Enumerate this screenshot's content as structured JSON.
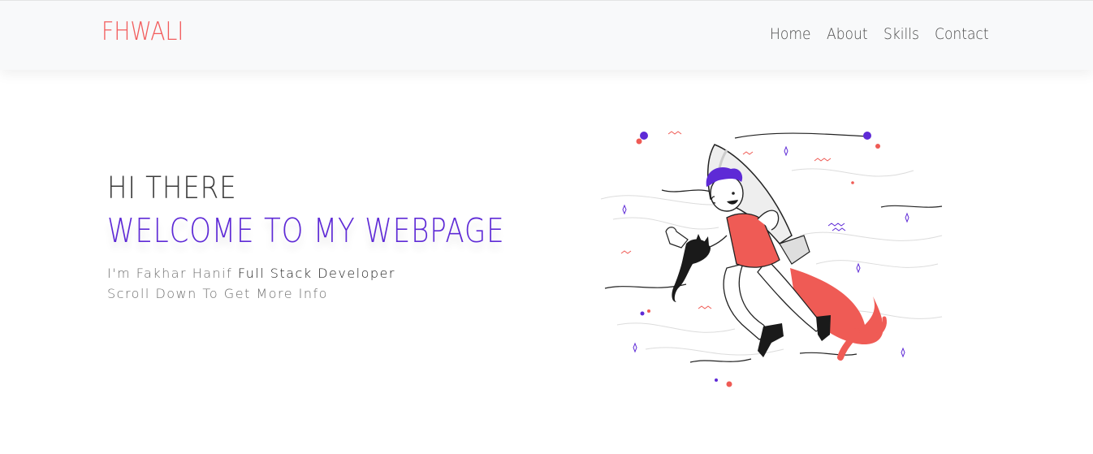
{
  "navbar": {
    "brand": "FHWALI",
    "links": [
      "Home",
      "About",
      "Skills",
      "Contact"
    ]
  },
  "hero": {
    "greeting": "HI THERE",
    "headline": "WELCOME TO MY WEBPAGE",
    "intro_prefix": "I'm Fakhar Hanif",
    "intro_role": "Full Stack Developer",
    "scroll_hint": "Scroll Down To Get More Info"
  },
  "colors": {
    "brand": "#f25c5c",
    "accent_purple": "#5e2ad6",
    "rocket_flame": "#ef5b55",
    "navbar_bg": "#f8f9fa"
  },
  "icons": {
    "illustration": "rocket-developer-illustration"
  }
}
